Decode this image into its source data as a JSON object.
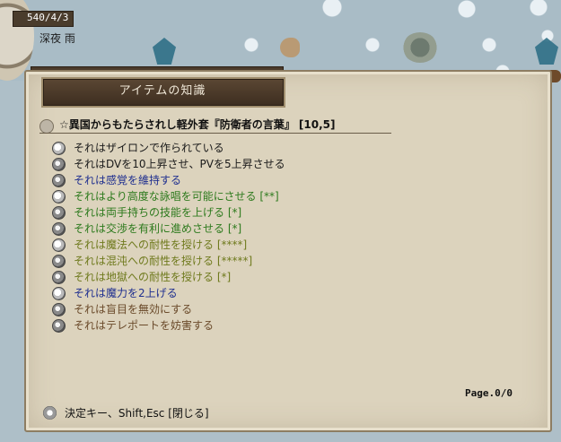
{
  "hud": {
    "date": "540/4/3",
    "weather": "深夜 雨"
  },
  "window": {
    "title": "アイテムの知識",
    "item_name": "☆異国からもたらされし軽外套『防衛者の言葉』 [10,5]",
    "lines": [
      {
        "text": "それはザイロンで作られている",
        "color": "#1a1a1a",
        "icon": "stone-icon"
      },
      {
        "text": "それはDVを10上昇させ、PVを5上昇させる",
        "color": "#1a1a1a",
        "icon": "armor-icon"
      },
      {
        "text": "それは感覚を維持する",
        "color": "#1f2f8f",
        "icon": "lock-icon"
      },
      {
        "text": "それはより高度な詠唱を可能にさせる [**]",
        "color": "#2d7a1d",
        "icon": "scroll-icon"
      },
      {
        "text": "それは両手持ちの技能を上げる [*]",
        "color": "#2d7a1d",
        "icon": "scroll-icon"
      },
      {
        "text": "それは交渉を有利に進めさせる [*]",
        "color": "#2d7a1d",
        "icon": "scroll-icon"
      },
      {
        "text": "それは魔法への耐性を授ける [****]",
        "color": "#6f7a1d",
        "icon": "orb-icon"
      },
      {
        "text": "それは混沌への耐性を授ける [*****]",
        "color": "#6f7a1d",
        "icon": "orb-icon"
      },
      {
        "text": "それは地獄への耐性を授ける [*]",
        "color": "#6f7a1d",
        "icon": "orb-icon"
      },
      {
        "text": "それは魔力を2上げる",
        "color": "#1f2f8f",
        "icon": "hand-icon"
      },
      {
        "text": "それは盲目を無効にする",
        "color": "#6a4a2a",
        "icon": "eye-icon"
      },
      {
        "text": "それはテレポートを妨害する",
        "color": "#6a4a2a",
        "icon": "eye-icon"
      }
    ],
    "page": "Page.0/0",
    "footer": "決定キー、Shift,Esc [閉じる]"
  }
}
